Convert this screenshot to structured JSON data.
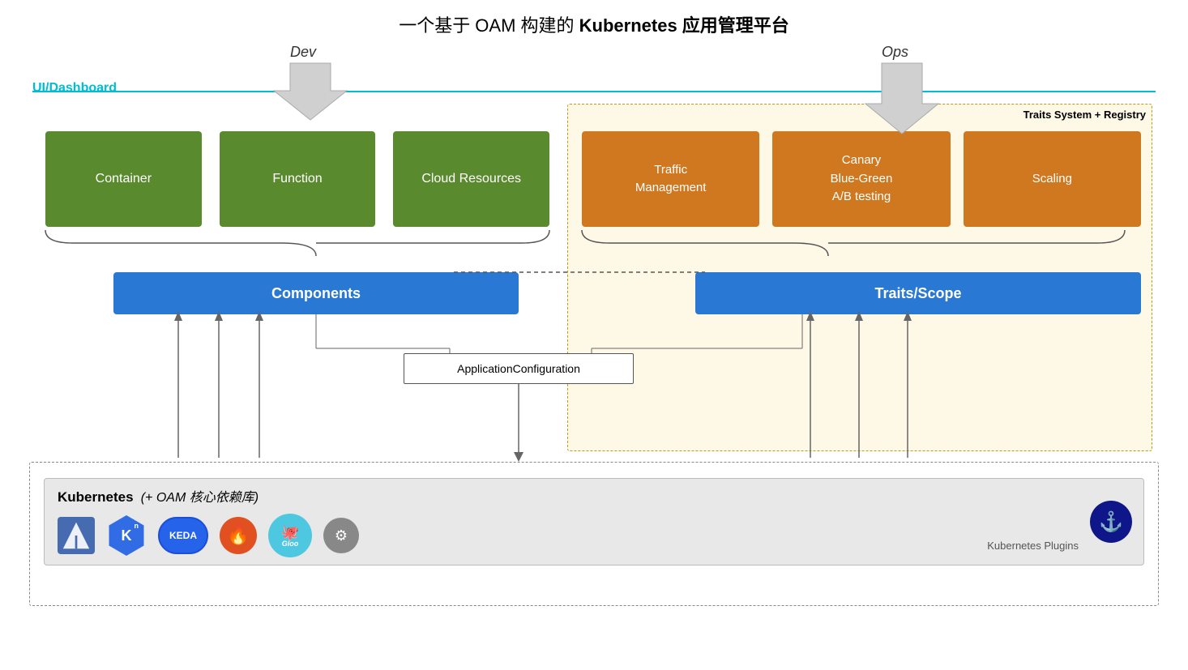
{
  "title": "一个基于 OAM 构建的 Kubernetes 应用管理平台",
  "title_bold_part": "Kubernetes 应用管理平台",
  "dev_label": "Dev",
  "ops_label": "Ops",
  "dashboard_label": "UI/Dashboard",
  "traits_system_label": "Traits System + Registry",
  "green_boxes": [
    {
      "label": "Container"
    },
    {
      "label": "Function"
    },
    {
      "label": "Cloud Resources"
    }
  ],
  "orange_boxes": [
    {
      "label": "Traffic\nManagement"
    },
    {
      "label": "Canary\nBlue-Green\nA/B testing"
    },
    {
      "label": "Scaling"
    }
  ],
  "components_label": "Components",
  "traits_scope_label": "Traits/Scope",
  "app_config_label": "ApplicationConfiguration",
  "k8s_title": "Kubernetes",
  "k8s_subtitle": "(+ OAM 核心依赖库)",
  "k8s_plugins_label": "Kubernetes Plugins",
  "logos": [
    {
      "name": "istio",
      "symbol": "⛵"
    },
    {
      "name": "kubernetes-k",
      "symbol": "K"
    },
    {
      "name": "keda",
      "symbol": "KEDA"
    },
    {
      "name": "fluxcd",
      "symbol": "🔥"
    },
    {
      "name": "gloo",
      "symbol": "Gloo"
    },
    {
      "name": "grey-plugin",
      "symbol": "⚙"
    }
  ]
}
